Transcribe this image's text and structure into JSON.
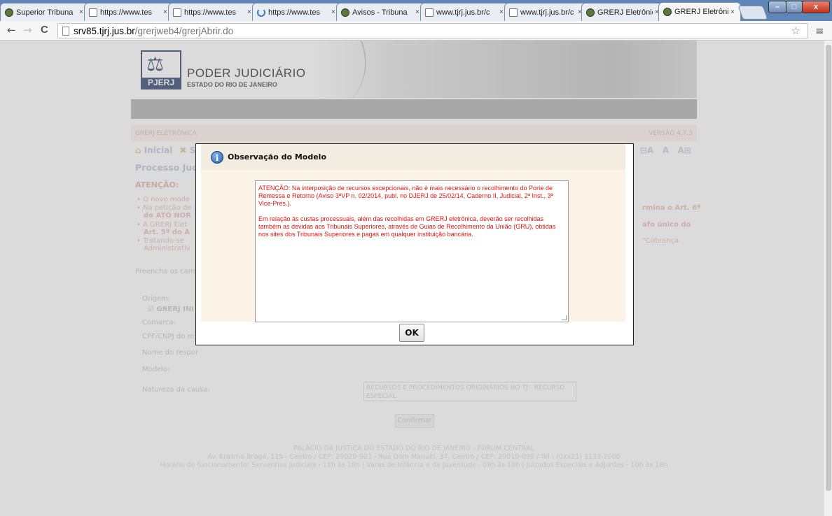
{
  "browser": {
    "tabs": [
      {
        "label": "Superior Tribuna",
        "icon": "seal-icon"
      },
      {
        "label": "https://www.tes",
        "icon": "page-icon"
      },
      {
        "label": "https://www.tes",
        "icon": "page-icon"
      },
      {
        "label": "https://www.tes",
        "icon": "loading-icon"
      },
      {
        "label": "Avisos - Tribuna",
        "icon": "seal-icon"
      },
      {
        "label": "www.tjrj.jus.br/c",
        "icon": "page-icon"
      },
      {
        "label": "www.tjrj.jus.br/c",
        "icon": "page-icon"
      },
      {
        "label": "GRERJ Eletrônica",
        "icon": "seal-icon"
      },
      {
        "label": "GRERJ Eletrônica",
        "icon": "seal-icon",
        "active": true
      }
    ],
    "close_glyph": "×",
    "window": {
      "minimize": "–",
      "maximize": "□",
      "close": "x"
    },
    "nav": {
      "back": "←",
      "forward": "→",
      "reload": "C"
    },
    "url_host": "srv85.tjrj.jus.br",
    "url_path": "/grerjweb4/grerjAbrir.do",
    "bookmark_glyph": "☆",
    "menu_glyph": "≡"
  },
  "header": {
    "logo_text": "PJERJ",
    "title": "PODER JUDICIÁRIO",
    "subtitle": "ESTADO DO RIO DE JANEIRO"
  },
  "page": {
    "system_name": "GRERJ ELETRÔNICA",
    "version": "VERSÃO 4.7.3",
    "home_link": "Inicial",
    "exit_link": "Sair",
    "font_controls": [
      "⊟A",
      "A",
      "A⊞"
    ],
    "section_title": "Processo Judicial",
    "attention_label": "ATENÇÃO:",
    "bullets": [
      "• O novo mode",
      "• Na petição de",
      "do ATO NOR",
      "• A GRERJ Elet",
      "Art. 5º do A",
      "• Tratando-se",
      "Administrativ"
    ],
    "bullet_right": [
      "rmina o Art. 6º",
      "afo único do",
      "\"Cobrança"
    ],
    "instructions": "Preencha os camp",
    "form": {
      "origin_label": "Origem:",
      "origin_option": "GRERJ INI",
      "district_label": "Comarca:",
      "document_label": "CPF/CNPJ do re",
      "responsible_label": "Nome do respor",
      "model_label": "Modelo:",
      "nature_label": "Natureza da causa:",
      "nature_value": "RECURSOS E PROCEDIMENTOS ORIGINÁRIOS NO TJ - RECURSO ESPECIAL"
    },
    "confirm_button": "Confirmar",
    "footer": [
      "PALÁCIO DA JUSTIÇA DO ESTADO DO RIO DE JANEIRO - FÓRUM CENTRAL",
      "Av. Erasmo Braga, 115 - Centro / CEP: 20020-903 - Rua Dom Manuel, 37, Centro / CEP: 20010-090 / Tel.: (0xx21) 3133-2000",
      "Horário de funcionamento: Serventias Judiciais - 11h às 18h | Varas de Infância e da Juventude - 09h às 18h | Juizados Especiais e Adjuntos - 10h às 18h"
    ]
  },
  "dialog": {
    "title": "Observação do Modelo",
    "message_p1": "ATENÇÃO: Na interposição de recursos excepcionais, não é mais necessário o recolhimento do Porte de Remessa e Retorno (Aviso 3ªVP n. 02/2014, publ. no DJERJ de 25/02/14, Caderno II, Judicial, 2ª Inst., 3ª Vice-Pres.).",
    "message_p2": "Em relação às custas processuais, além das recolhidas em GRERJ eletrônica, deverão ser recolhidas também as devidas aos Tribunais Superiores, através de Guias de Recolhimento da União (GRU), obtidas nos sites dos Tribunais Superiores e pagas em qualquer instituição bancária.",
    "ok_label": "OK"
  },
  "colors": {
    "message_text": "#e3140e",
    "dialog_header": "#f3ece0",
    "dialog_body": "#fbf3e6",
    "tabstrip": "#5f86b8"
  }
}
